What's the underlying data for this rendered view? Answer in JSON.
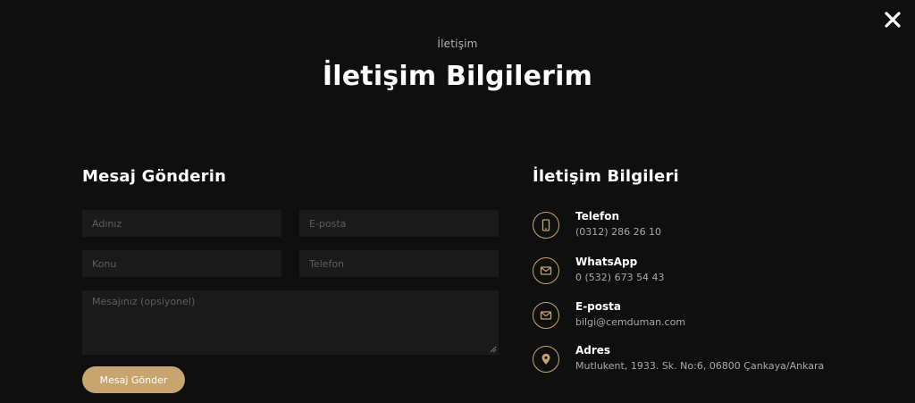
{
  "header": {
    "eyebrow": "İletişim",
    "title": "İletişim Bilgilerim"
  },
  "form": {
    "title": "Mesaj Gönderin",
    "name_placeholder": "Adınız",
    "email_placeholder": "E-posta",
    "subject_placeholder": "Konu",
    "phone_placeholder": "Telefon",
    "message_placeholder": "Mesajınız (opsiyonel)",
    "submit_label": "Mesaj Gönder"
  },
  "contact": {
    "title": "İletişim Bilgileri",
    "items": [
      {
        "icon": "mobile-phone-icon",
        "label": "Telefon",
        "value": "(0312) 286 26 10"
      },
      {
        "icon": "envelope-icon",
        "label": "WhatsApp",
        "value": "0 (532) 673 54 43"
      },
      {
        "icon": "envelope-icon",
        "label": "E-posta",
        "value": "bilgi@cemduman.com"
      },
      {
        "icon": "map-pin-icon",
        "label": "Adres",
        "value": "Mutlukent, 1933. Sk. No:6, 06800 Çankaya/Ankara"
      }
    ]
  },
  "colors": {
    "background": "#0f0f0f",
    "field_background": "#1a1a1a",
    "accent": "#c8a46e",
    "text": "#ffffff",
    "muted_text": "#a9a9a9"
  },
  "icons": {
    "close": "close-icon"
  }
}
